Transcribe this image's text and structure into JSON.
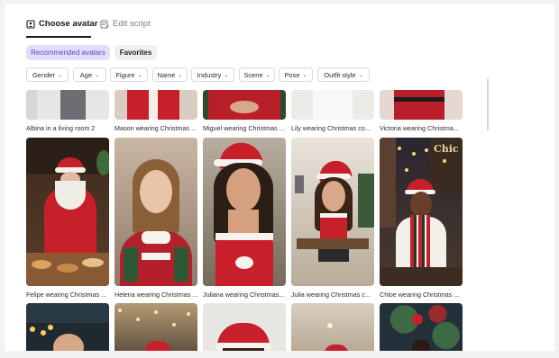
{
  "tabs": {
    "choose_avatar": "Choose avatar",
    "edit_script": "Edit script"
  },
  "pills": {
    "recommended": "Recommended avatars",
    "favorites": "Favorites"
  },
  "filters": [
    "Gender",
    "Age",
    "Figure",
    "Name",
    "Industry",
    "Scene",
    "Pose",
    "Outfit style"
  ],
  "avatars": {
    "row1": [
      "Albina in a living room 2",
      "Mason wearing Christmas ...",
      "Miguel wearing Christmas ...",
      "Lily wearing Christmas co...",
      "Victoria wearing Christma..."
    ],
    "row2": [
      "Felipe wearing Christmas ...",
      "Helena wearing Christmas ...",
      "Juliana wearing Christmas...",
      "Julia wearing Christmas c...",
      "Chloe wearing Christmas ..."
    ],
    "row2_overlay": "Chic"
  },
  "colors": {
    "accent": "#5b48c9",
    "accent_bg": "#e3defb",
    "santa_red": "#c8202b"
  }
}
